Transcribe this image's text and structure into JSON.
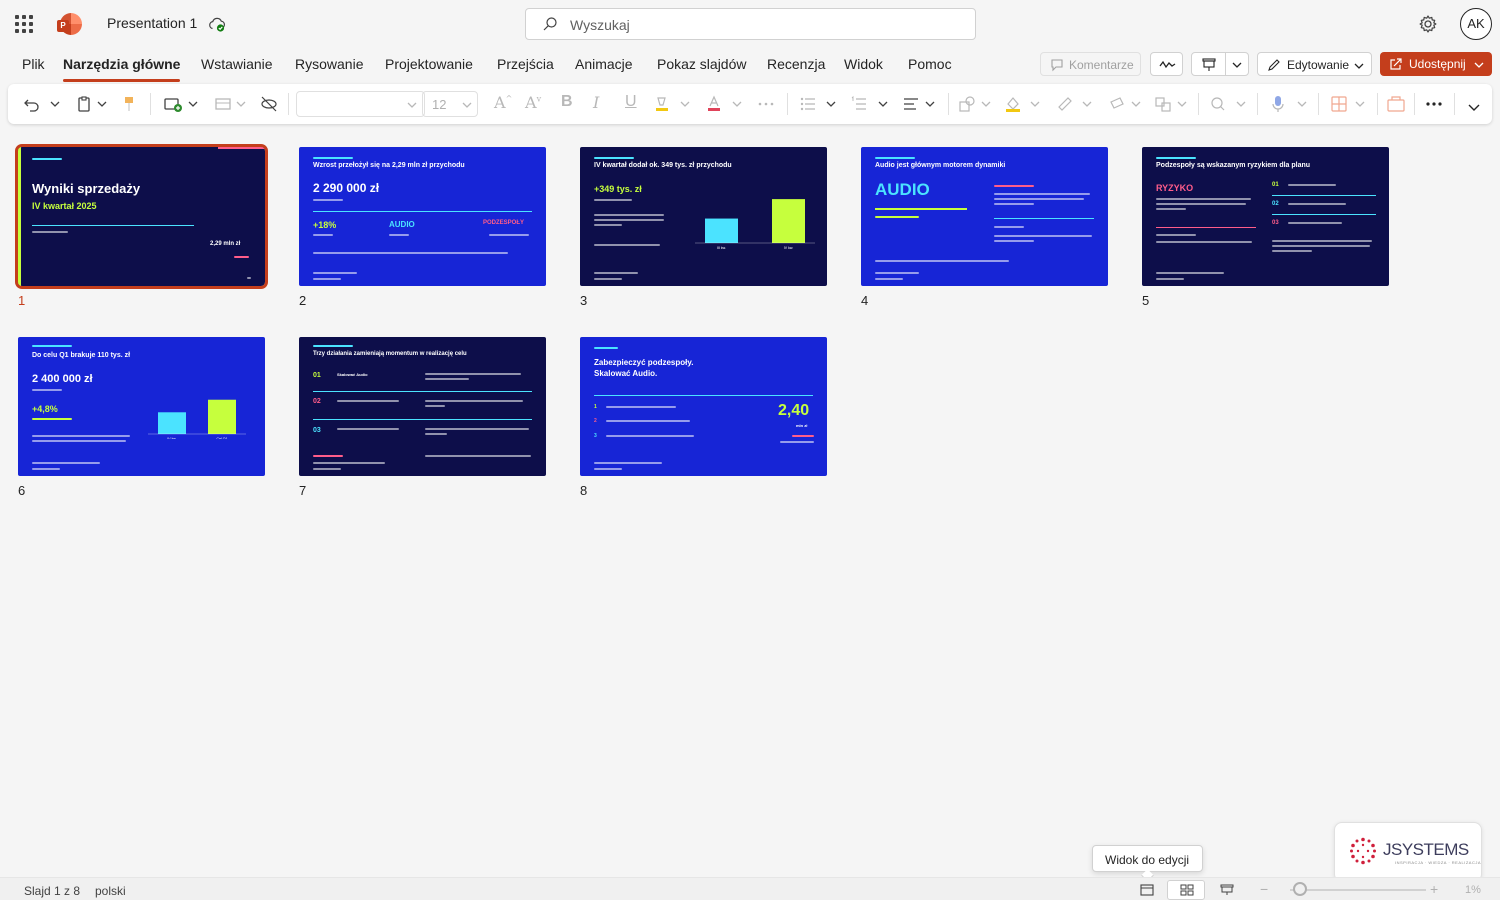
{
  "app": {
    "document_title": "Presentation 1",
    "search_placeholder": "Wyszukaj",
    "avatar_initials": "AK"
  },
  "ribbon": {
    "tabs": [
      "Plik",
      "Narzędzia główne",
      "Wstawianie",
      "Rysowanie",
      "Projektowanie",
      "Przejścia",
      "Animacje",
      "Pokaz slajdów",
      "Recenzja",
      "Widok",
      "Pomoc"
    ],
    "active_tab": "Narzędzia główne",
    "comments_label": "Komentarze",
    "editing_label": "Edytowanie",
    "share_label": "Udostępnij",
    "font_size": "12",
    "accent_color": "#c43e1c"
  },
  "slides": [
    {
      "number": "1",
      "selected": true,
      "title": "Wyniki sprzedaży",
      "subtitle": "IV kwartał 2025",
      "value": "2,29 mln zł"
    },
    {
      "number": "2",
      "title": "Wzrost przełożył się na 2,29 mln zł przychodu",
      "big_value": "2 290 000 zł",
      "metric": "+18%",
      "label_audio": "AUDIO",
      "label_parts": "PODZESPOŁY"
    },
    {
      "number": "3",
      "title": "IV kwartał dodał ok. 349 tys. zł przychodu",
      "metric": "+349 tys. zł",
      "chart_data": {
        "type": "bar",
        "categories": [
          "III kw.",
          "IV kw."
        ],
        "values": [
          1.94,
          2.29
        ],
        "ylim": [
          1.5,
          2.4
        ]
      }
    },
    {
      "number": "4",
      "title": "Audio jest głównym motorem dynamiki",
      "big_label": "AUDIO"
    },
    {
      "number": "5",
      "title": "Podzespoły są wskazanym ryzykiem dla planu",
      "big_label": "RYZYKO",
      "items": [
        "01",
        "02",
        "03"
      ]
    },
    {
      "number": "6",
      "title": "Do celu Q1 brakuje 110 tys. zł",
      "big_value": "2 400 000 zł",
      "metric": "+4,8%",
      "chart_data": {
        "type": "bar",
        "categories": [
          "IV kw.",
          "Cel Q1"
        ],
        "values": [
          2.29,
          2.4
        ],
        "ylim": [
          2.1,
          2.45
        ]
      }
    },
    {
      "number": "7",
      "title": "Trzy działania zamieniają momentum w realizację celu",
      "items": [
        "01",
        "02",
        "03"
      ],
      "item_labels": [
        "Skalować Audio"
      ]
    },
    {
      "number": "8",
      "title_line1": "Zabezpieczyć podzespoły.",
      "title_line2": "Skalować Audio.",
      "big_value": "2,40",
      "unit": "mln zł",
      "items": [
        "1",
        "2",
        "3"
      ]
    }
  ],
  "status": {
    "slide_counter": "Slajd 1 z 8",
    "language": "polski",
    "zoom": "1%",
    "tooltip": "Widok do edycji"
  },
  "brand": {
    "name": "JSYSTEMS",
    "tagline": "INSPIRACJA · WIEDZA · REALIZACJA"
  }
}
